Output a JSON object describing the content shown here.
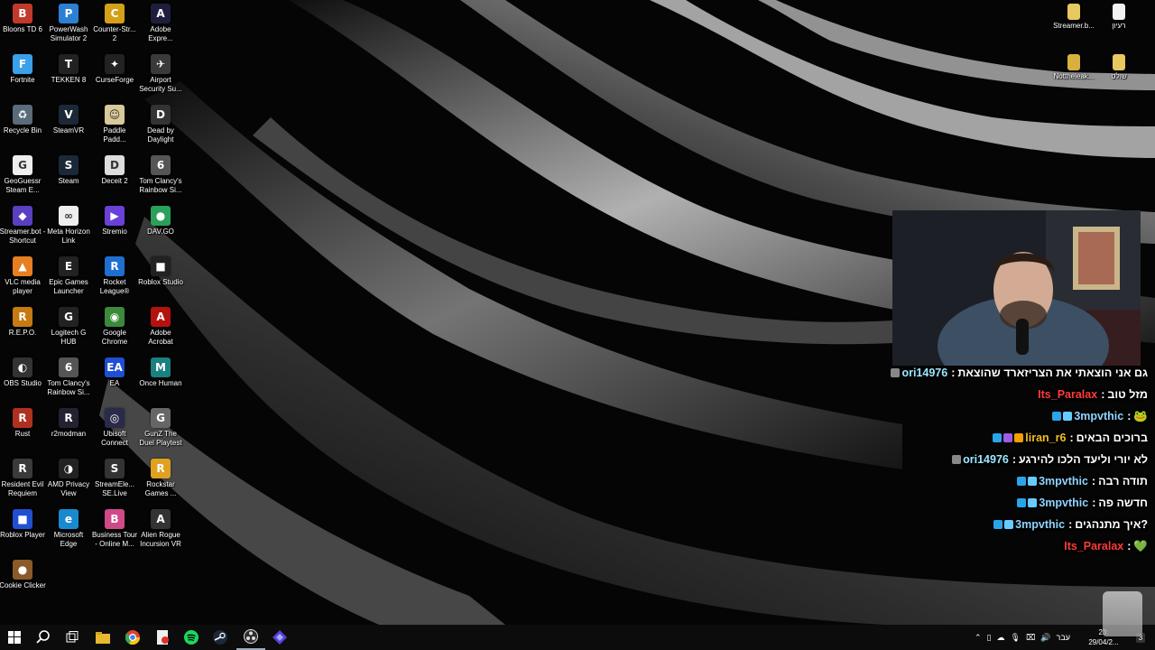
{
  "desktop_icons": [
    {
      "label": "Bloons TD 6",
      "icon": "bloons-icon",
      "color": "#c0392b",
      "glyph": "B"
    },
    {
      "label": "PowerWash Simulator 2",
      "icon": "powerwash-icon",
      "color": "#2d7fd3",
      "glyph": "P"
    },
    {
      "label": "Counter-Str... 2",
      "icon": "counter-strike-icon",
      "color": "#d4a017",
      "glyph": "C"
    },
    {
      "label": "Adobe Expre...",
      "icon": "adobe-express-icon",
      "color": "#1e1e3c",
      "glyph": "A"
    },
    {
      "label": "Fortnite",
      "icon": "fortnite-icon",
      "color": "#3aa0e8",
      "glyph": "F"
    },
    {
      "label": "TEKKEN 8",
      "icon": "tekken-icon",
      "color": "#222",
      "glyph": "T"
    },
    {
      "label": "CurseForge",
      "icon": "curseforge-icon",
      "color": "#222",
      "glyph": "✦"
    },
    {
      "label": "Airport Security Su...",
      "icon": "airport-icon",
      "color": "#3a3a3a",
      "glyph": "✈"
    },
    {
      "label": "Recycle Bin",
      "icon": "recycle-bin-icon",
      "color": "#5a6b7a",
      "glyph": "♻"
    },
    {
      "label": "SteamVR",
      "icon": "steamvr-icon",
      "color": "#1b2838",
      "glyph": "V"
    },
    {
      "label": "Paddle Padd...",
      "icon": "paddle-icon",
      "color": "#d8c89a",
      "glyph": "☺"
    },
    {
      "label": "Dead by Daylight",
      "icon": "dead-by-daylight-icon",
      "color": "#333",
      "glyph": "D"
    },
    {
      "label": "GeoGuessr Steam E...",
      "icon": "geoguessr-icon",
      "color": "#eee",
      "glyph": "G"
    },
    {
      "label": "Steam",
      "icon": "steam-icon",
      "color": "#1b2838",
      "glyph": "S"
    },
    {
      "label": "Deceit 2",
      "icon": "deceit-icon",
      "color": "#ddd",
      "glyph": "D"
    },
    {
      "label": "Tom Clancy's Rainbow Si...",
      "icon": "rainbow-six-icon",
      "color": "#555",
      "glyph": "6"
    },
    {
      "label": "Streamer.bot - Shortcut",
      "icon": "streamerbot-icon",
      "color": "#5a3fc0",
      "glyph": "◆"
    },
    {
      "label": "Meta Horizon Link",
      "icon": "meta-icon",
      "color": "#eee",
      "glyph": "∞"
    },
    {
      "label": "Stremio",
      "icon": "stremio-icon",
      "color": "#6a40d8",
      "glyph": "▶"
    },
    {
      "label": "DAV.GO",
      "icon": "davgo-icon",
      "color": "#2aa05a",
      "glyph": "●"
    },
    {
      "label": "VLC media player",
      "icon": "vlc-icon",
      "color": "#e67e22",
      "glyph": "▲"
    },
    {
      "label": "Epic Games Launcher",
      "icon": "epic-games-icon",
      "color": "#222",
      "glyph": "E"
    },
    {
      "label": "Rocket League®",
      "icon": "rocket-league-icon",
      "color": "#1f6fd1",
      "glyph": "R"
    },
    {
      "label": "Roblox Studio",
      "icon": "roblox-studio-icon",
      "color": "#222",
      "glyph": "■"
    },
    {
      "label": "R.E.P.O.",
      "icon": "repo-icon",
      "color": "#c57a12",
      "glyph": "R"
    },
    {
      "label": "Logitech G HUB",
      "icon": "logitech-icon",
      "color": "#222",
      "glyph": "G"
    },
    {
      "label": "Google Chrome",
      "icon": "chrome-icon",
      "color": "#3a8a3a",
      "glyph": "◉"
    },
    {
      "label": "Adobe Acrobat",
      "icon": "acrobat-icon",
      "color": "#b3120f",
      "glyph": "A"
    },
    {
      "label": "OBS Studio",
      "icon": "obs-icon",
      "color": "#333",
      "glyph": "◐"
    },
    {
      "label": "Tom Clancy's Rainbow Si...",
      "icon": "rainbow-six-icon",
      "color": "#555",
      "glyph": "6"
    },
    {
      "label": "EA",
      "icon": "ea-icon",
      "color": "#1f4fd1",
      "glyph": "EA"
    },
    {
      "label": "Once Human",
      "icon": "once-human-icon",
      "color": "#1a8080",
      "glyph": "M"
    },
    {
      "label": "Rust",
      "icon": "rust-icon",
      "color": "#b0301f",
      "glyph": "R"
    },
    {
      "label": "r2modman",
      "icon": "r2modman-icon",
      "color": "#223",
      "glyph": "R"
    },
    {
      "label": "Ubisoft Connect",
      "icon": "ubisoft-icon",
      "color": "#2a2a4a",
      "glyph": "◎"
    },
    {
      "label": "GunZ The Duel Playtest",
      "icon": "gunz-icon",
      "color": "#666",
      "glyph": "G"
    },
    {
      "label": "Resident Evil Requiem",
      "icon": "resident-evil-icon",
      "color": "#3a3a3a",
      "glyph": "R"
    },
    {
      "label": "AMD Privacy View",
      "icon": "amd-icon",
      "color": "#222",
      "glyph": "◑"
    },
    {
      "label": "StreamEle... SE.Live",
      "icon": "streamelements-icon",
      "color": "#333",
      "glyph": "S"
    },
    {
      "label": "Rockstar Games ...",
      "icon": "rockstar-icon",
      "color": "#e0a020",
      "glyph": "R"
    },
    {
      "label": "Roblox Player",
      "icon": "roblox-player-icon",
      "color": "#2050d0",
      "glyph": "■"
    },
    {
      "label": "Microsoft Edge",
      "icon": "edge-icon",
      "color": "#1a8ad0",
      "glyph": "e"
    },
    {
      "label": "Business Tour - Online M...",
      "icon": "business-tour-icon",
      "color": "#d04a8a",
      "glyph": "B"
    },
    {
      "label": "Alien Rogue Incursion VR",
      "icon": "alien-rogue-icon",
      "color": "#333",
      "glyph": "A"
    },
    {
      "label": "Cookie Clicker",
      "icon": "cookie-clicker-icon",
      "color": "#8a5a2a",
      "glyph": "●"
    }
  ],
  "right_icons": [
    {
      "label": "Streamer.b...",
      "icon": "folder-icon",
      "color": "#e8c860",
      "glyph": ""
    },
    {
      "label": "רעיון",
      "icon": "text-file-icon",
      "color": "#f2f2f2",
      "glyph": ""
    },
    {
      "label": "Nottheleak...",
      "icon": "folder-icon",
      "color": "#d8b040",
      "glyph": ""
    },
    {
      "label": "שולט",
      "icon": "folder-icon",
      "color": "#e8c860",
      "glyph": ""
    }
  ],
  "chat": [
    {
      "user": "ori14976",
      "user_color": "#9be8ff",
      "message": "גם אני הוצאתי את הצריזארד שהוצאת",
      "badges": [
        "#888"
      ]
    },
    {
      "user": "Its_Paralax",
      "user_color": "#ff3b3b",
      "message": "מזל טוב",
      "badges": []
    },
    {
      "user": "3mpvthic",
      "user_color": "#8fd4ff",
      "message": "🐸",
      "badges": [
        "#2aa4e8",
        "#6cf"
      ]
    },
    {
      "user": "liran_r6",
      "user_color": "#f0c020",
      "message": "ברוכים הבאים",
      "badges": [
        "#2aa4e8",
        "#9b5de5",
        "#f0a000"
      ]
    },
    {
      "user": "ori14976",
      "user_color": "#9be8ff",
      "message": "לא יורי וליעד הלכו להירגע",
      "badges": [
        "#888"
      ]
    },
    {
      "user": "3mpvthic",
      "user_color": "#8fd4ff",
      "message": "תודה רבה",
      "badges": [
        "#2aa4e8",
        "#6cf"
      ]
    },
    {
      "user": "3mpvthic",
      "user_color": "#8fd4ff",
      "message": "חדשה פה",
      "badges": [
        "#2aa4e8",
        "#6cf"
      ]
    },
    {
      "user": "3mpvthic",
      "user_color": "#8fd4ff",
      "message": "?איך מתנהגים",
      "badges": [
        "#2aa4e8",
        "#6cf"
      ]
    },
    {
      "user": "Its_Paralax",
      "user_color": "#ff3b3b",
      "message": "💚",
      "badges": []
    }
  ],
  "taskbar": {
    "pinned": [
      "start-icon",
      "search-icon",
      "task-view-icon",
      "file-explorer-icon",
      "chrome-icon",
      "streamerbot-icon",
      "spotify-icon",
      "steam-icon",
      "obs-icon",
      "streamerbot-app-icon"
    ],
    "language": "עבר",
    "time": "23:",
    "date": "29/04/2...",
    "notification_count": "3"
  }
}
